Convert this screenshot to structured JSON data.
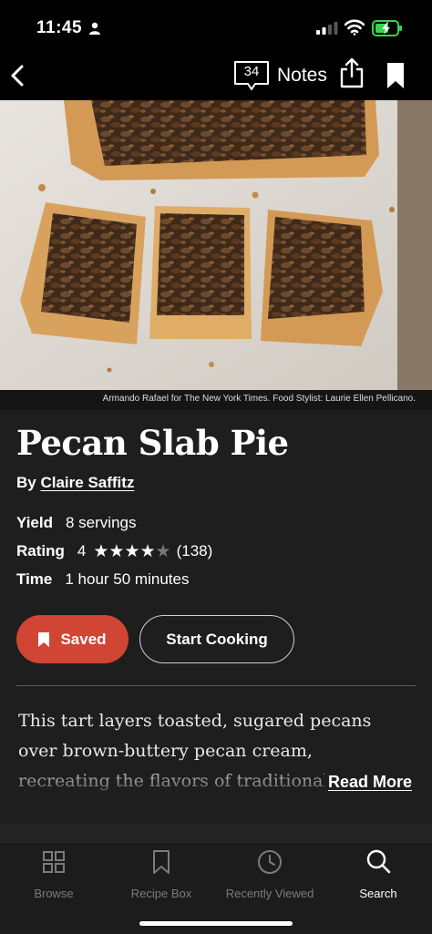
{
  "status_bar": {
    "time": "11:45",
    "battery_color": "#32d74b"
  },
  "top_bar": {
    "notes_count": "34",
    "notes_label": "Notes"
  },
  "photo_credit": "Armando Rafael for The New York Times. Food Stylist: Laurie Ellen Pellicano.",
  "recipe": {
    "title": "Pecan Slab Pie",
    "by_prefix": "By",
    "author": "Claire Saffitz",
    "yield_label": "Yield",
    "yield_value": "8 servings",
    "rating_label": "Rating",
    "rating_value": "4",
    "rating_stars_filled": 4,
    "rating_stars_total": 5,
    "rating_count": "(138)",
    "time_label": "Time",
    "time_value": "1 hour 50 minutes",
    "description": "This tart layers toasted, sugared pecans over brown-buttery pecan cream, recreating the flavors of traditional pecan pie but w",
    "read_more": "Read More"
  },
  "actions": {
    "saved_label": "Saved",
    "start_label": "Start Cooking",
    "saved_color": "#d14534"
  },
  "tabs": [
    {
      "label": "Browse",
      "icon": "grid-icon",
      "active": false
    },
    {
      "label": "Recipe Box",
      "icon": "bookmark-icon",
      "active": false
    },
    {
      "label": "Recently Viewed",
      "icon": "clock-icon",
      "active": false
    },
    {
      "label": "Search",
      "icon": "search-icon",
      "active": true
    }
  ]
}
